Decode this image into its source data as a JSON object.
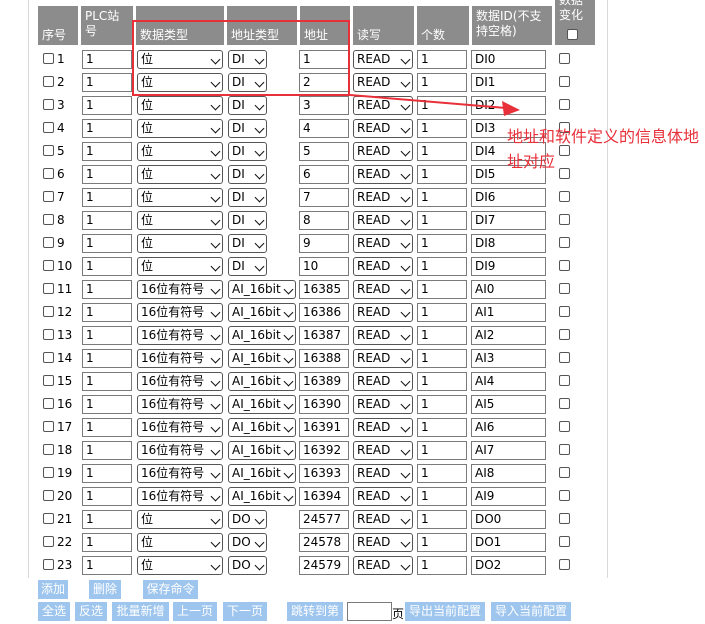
{
  "headers": {
    "seq": "序号",
    "plc_station": [
      "PLC站",
      "号"
    ],
    "data_type": "数据类型",
    "addr_type": "地址类型",
    "address": "地址",
    "rw": "读写",
    "count": "个数",
    "data_id": [
      "数据ID(不支",
      "持空格)"
    ],
    "change": [
      "数据",
      "变化"
    ]
  },
  "rows": [
    {
      "seq": "1",
      "station": "1",
      "data_type": "位",
      "addr_type": "DI",
      "address": "1",
      "rw": "READ",
      "count": "1",
      "data_id": "DI0"
    },
    {
      "seq": "2",
      "station": "1",
      "data_type": "位",
      "addr_type": "DI",
      "address": "2",
      "rw": "READ",
      "count": "1",
      "data_id": "DI1"
    },
    {
      "seq": "3",
      "station": "1",
      "data_type": "位",
      "addr_type": "DI",
      "address": "3",
      "rw": "READ",
      "count": "1",
      "data_id": "DI2"
    },
    {
      "seq": "4",
      "station": "1",
      "data_type": "位",
      "addr_type": "DI",
      "address": "4",
      "rw": "READ",
      "count": "1",
      "data_id": "DI3"
    },
    {
      "seq": "5",
      "station": "1",
      "data_type": "位",
      "addr_type": "DI",
      "address": "5",
      "rw": "READ",
      "count": "1",
      "data_id": "DI4"
    },
    {
      "seq": "6",
      "station": "1",
      "data_type": "位",
      "addr_type": "DI",
      "address": "6",
      "rw": "READ",
      "count": "1",
      "data_id": "DI5"
    },
    {
      "seq": "7",
      "station": "1",
      "data_type": "位",
      "addr_type": "DI",
      "address": "7",
      "rw": "READ",
      "count": "1",
      "data_id": "DI6"
    },
    {
      "seq": "8",
      "station": "1",
      "data_type": "位",
      "addr_type": "DI",
      "address": "8",
      "rw": "READ",
      "count": "1",
      "data_id": "DI7"
    },
    {
      "seq": "9",
      "station": "1",
      "data_type": "位",
      "addr_type": "DI",
      "address": "9",
      "rw": "READ",
      "count": "1",
      "data_id": "DI8"
    },
    {
      "seq": "10",
      "station": "1",
      "data_type": "位",
      "addr_type": "DI",
      "address": "10",
      "rw": "READ",
      "count": "1",
      "data_id": "DI9"
    },
    {
      "seq": "11",
      "station": "1",
      "data_type": "16位有符号",
      "addr_type": "AI_16bit",
      "address": "16385",
      "rw": "READ",
      "count": "1",
      "data_id": "AI0"
    },
    {
      "seq": "12",
      "station": "1",
      "data_type": "16位有符号",
      "addr_type": "AI_16bit",
      "address": "16386",
      "rw": "READ",
      "count": "1",
      "data_id": "AI1"
    },
    {
      "seq": "13",
      "station": "1",
      "data_type": "16位有符号",
      "addr_type": "AI_16bit",
      "address": "16387",
      "rw": "READ",
      "count": "1",
      "data_id": "AI2"
    },
    {
      "seq": "14",
      "station": "1",
      "data_type": "16位有符号",
      "addr_type": "AI_16bit",
      "address": "16388",
      "rw": "READ",
      "count": "1",
      "data_id": "AI3"
    },
    {
      "seq": "15",
      "station": "1",
      "data_type": "16位有符号",
      "addr_type": "AI_16bit",
      "address": "16389",
      "rw": "READ",
      "count": "1",
      "data_id": "AI4"
    },
    {
      "seq": "16",
      "station": "1",
      "data_type": "16位有符号",
      "addr_type": "AI_16bit",
      "address": "16390",
      "rw": "READ",
      "count": "1",
      "data_id": "AI5"
    },
    {
      "seq": "17",
      "station": "1",
      "data_type": "16位有符号",
      "addr_type": "AI_16bit",
      "address": "16391",
      "rw": "READ",
      "count": "1",
      "data_id": "AI6"
    },
    {
      "seq": "18",
      "station": "1",
      "data_type": "16位有符号",
      "addr_type": "AI_16bit",
      "address": "16392",
      "rw": "READ",
      "count": "1",
      "data_id": "AI7"
    },
    {
      "seq": "19",
      "station": "1",
      "data_type": "16位有符号",
      "addr_type": "AI_16bit",
      "address": "16393",
      "rw": "READ",
      "count": "1",
      "data_id": "AI8"
    },
    {
      "seq": "20",
      "station": "1",
      "data_type": "16位有符号",
      "addr_type": "AI_16bit",
      "address": "16394",
      "rw": "READ",
      "count": "1",
      "data_id": "AI9"
    },
    {
      "seq": "21",
      "station": "1",
      "data_type": "位",
      "addr_type": "DO",
      "address": "24577",
      "rw": "READ",
      "count": "1",
      "data_id": "DO0"
    },
    {
      "seq": "22",
      "station": "1",
      "data_type": "位",
      "addr_type": "DO",
      "address": "24578",
      "rw": "READ",
      "count": "1",
      "data_id": "DO1"
    },
    {
      "seq": "23",
      "station": "1",
      "data_type": "位",
      "addr_type": "DO",
      "address": "24579",
      "rw": "READ",
      "count": "1",
      "data_id": "DO2"
    }
  ],
  "buttons_row1": [
    "添加",
    "删除",
    "保存命令"
  ],
  "buttons_row2": [
    "全选",
    "反选",
    "批量新增",
    "上一页",
    "下一页",
    "跳转到第"
  ],
  "page_suffix": "页",
  "buttons_row2b": [
    "导出当前配置",
    "导入当前配置"
  ],
  "annotation": "地址和软件定义的信息体地址对应",
  "colors": {
    "header_bg": "#8c8c8c",
    "button_bg": "#9ec5ee",
    "annotation": "#e8303a"
  }
}
